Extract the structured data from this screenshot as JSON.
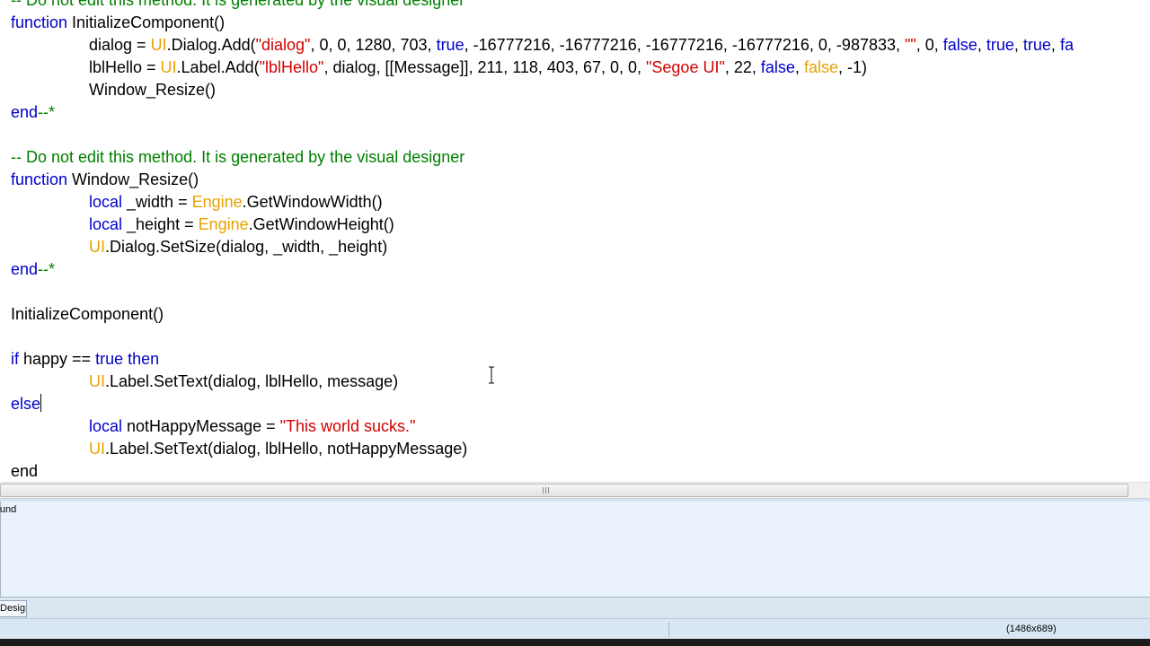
{
  "editor": {
    "lines": [
      {
        "indent": false,
        "tokens": [
          {
            "t": "-- Do not edit this method. It is generated by the visual designer",
            "c": "comment"
          }
        ]
      },
      {
        "indent": false,
        "tokens": [
          {
            "t": "function",
            "c": "keyword"
          },
          {
            "t": " InitializeComponent()",
            "c": "plain"
          }
        ]
      },
      {
        "indent": true,
        "tokens": [
          {
            "t": "dialog = ",
            "c": "plain"
          },
          {
            "t": "UI",
            "c": "ui"
          },
          {
            "t": ".Dialog.Add(",
            "c": "plain"
          },
          {
            "t": "\"dialog\"",
            "c": "string"
          },
          {
            "t": ", 0, 0, 1280, 703, ",
            "c": "plain"
          },
          {
            "t": "true",
            "c": "keyword"
          },
          {
            "t": ", -16777216, -16777216, -16777216, -16777216, 0, -987833, ",
            "c": "plain"
          },
          {
            "t": "\"\"",
            "c": "string"
          },
          {
            "t": ", 0, ",
            "c": "plain"
          },
          {
            "t": "false",
            "c": "keyword"
          },
          {
            "t": ", ",
            "c": "plain"
          },
          {
            "t": "true",
            "c": "keyword"
          },
          {
            "t": ", ",
            "c": "plain"
          },
          {
            "t": "true",
            "c": "keyword"
          },
          {
            "t": ", ",
            "c": "plain"
          },
          {
            "t": "fa",
            "c": "keyword"
          }
        ]
      },
      {
        "indent": true,
        "tokens": [
          {
            "t": "lblHello = ",
            "c": "plain"
          },
          {
            "t": "UI",
            "c": "ui"
          },
          {
            "t": ".Label.Add(",
            "c": "plain"
          },
          {
            "t": "\"lblHello\"",
            "c": "string"
          },
          {
            "t": ", dialog, [[Message]], 211, 118, 403, 67, 0, 0, ",
            "c": "plain"
          },
          {
            "t": "\"Segoe UI\"",
            "c": "string"
          },
          {
            "t": ", 22, ",
            "c": "plain"
          },
          {
            "t": "false",
            "c": "keyword"
          },
          {
            "t": ", ",
            "c": "plain"
          },
          {
            "t": "false",
            "c": "ui"
          },
          {
            "t": ", -1)",
            "c": "plain"
          }
        ]
      },
      {
        "indent": true,
        "tokens": [
          {
            "t": "Window_Resize()",
            "c": "plain"
          }
        ]
      },
      {
        "indent": false,
        "tokens": [
          {
            "t": "end",
            "c": "keyword"
          },
          {
            "t": "--*",
            "c": "comment"
          }
        ]
      },
      {
        "indent": false,
        "tokens": []
      },
      {
        "indent": false,
        "tokens": [
          {
            "t": "-- Do not edit this method. It is generated by the visual designer",
            "c": "comment"
          }
        ]
      },
      {
        "indent": false,
        "tokens": [
          {
            "t": "function",
            "c": "keyword"
          },
          {
            "t": " Window_Resize()",
            "c": "plain"
          }
        ]
      },
      {
        "indent": true,
        "tokens": [
          {
            "t": "local",
            "c": "keyword"
          },
          {
            "t": " _width = ",
            "c": "plain"
          },
          {
            "t": "Engine",
            "c": "ui"
          },
          {
            "t": ".GetWindowWidth()",
            "c": "plain"
          }
        ]
      },
      {
        "indent": true,
        "tokens": [
          {
            "t": "local",
            "c": "keyword"
          },
          {
            "t": " _height = ",
            "c": "plain"
          },
          {
            "t": "Engine",
            "c": "ui"
          },
          {
            "t": ".GetWindowHeight()",
            "c": "plain"
          }
        ]
      },
      {
        "indent": true,
        "tokens": [
          {
            "t": "UI",
            "c": "ui"
          },
          {
            "t": ".Dialog.SetSize(dialog, _width, _height)",
            "c": "plain"
          }
        ]
      },
      {
        "indent": false,
        "tokens": [
          {
            "t": "end",
            "c": "keyword"
          },
          {
            "t": "--*",
            "c": "comment"
          }
        ]
      },
      {
        "indent": false,
        "tokens": []
      },
      {
        "indent": false,
        "tokens": [
          {
            "t": "InitializeComponent()",
            "c": "plain"
          }
        ]
      },
      {
        "indent": false,
        "tokens": []
      },
      {
        "indent": false,
        "tokens": [
          {
            "t": "if",
            "c": "keyword"
          },
          {
            "t": " happy == ",
            "c": "plain"
          },
          {
            "t": "true",
            "c": "keyword"
          },
          {
            "t": " ",
            "c": "plain"
          },
          {
            "t": "then",
            "c": "keyword"
          }
        ]
      },
      {
        "indent": true,
        "tokens": [
          {
            "t": "UI",
            "c": "ui"
          },
          {
            "t": ".Label.SetText(dialog, lblHello, message)",
            "c": "plain"
          }
        ]
      },
      {
        "indent": false,
        "caret": true,
        "tokens": [
          {
            "t": "else",
            "c": "keyword"
          }
        ]
      },
      {
        "indent": true,
        "tokens": [
          {
            "t": "local",
            "c": "keyword"
          },
          {
            "t": " notHappyMessage = ",
            "c": "plain"
          },
          {
            "t": "\"This world sucks.\"",
            "c": "string"
          }
        ]
      },
      {
        "indent": true,
        "tokens": [
          {
            "t": "UI",
            "c": "ui"
          },
          {
            "t": ".Label.SetText(dialog, lblHello, notHappyMessage)",
            "c": "plain"
          }
        ]
      },
      {
        "indent": false,
        "tokens": [
          {
            "t": "end",
            "c": "plain"
          }
        ]
      }
    ]
  },
  "output_panel": {
    "text": "Found"
  },
  "tabs": [
    {
      "label": "Design"
    }
  ],
  "status_bar": {
    "window_size": "(1486x689)"
  },
  "colors": {
    "keyword": "#0000c8",
    "comment": "#008000",
    "string": "#d40000",
    "ui_identifier": "#e8a200"
  }
}
